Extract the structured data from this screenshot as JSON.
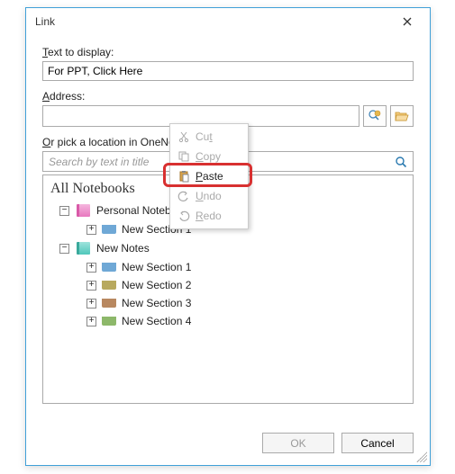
{
  "dialog": {
    "title": "Link",
    "text_to_display_label": "Text to display:",
    "text_to_display_value": "For PPT, Click Here",
    "address_label": "Address:",
    "address_value": "",
    "pick_location_label": "Or pick a location in OneNote:",
    "search_placeholder": "Search by text in title",
    "ok_label": "OK",
    "cancel_label": "Cancel"
  },
  "tree": {
    "header": "All Notebooks",
    "notebooks": [
      {
        "name": "Personal Notebook",
        "color": "pink",
        "expanded": true,
        "sections": [
          {
            "name": "New Section 1",
            "color": "blue"
          }
        ]
      },
      {
        "name": "New Notes",
        "color": "teal",
        "expanded": true,
        "sections": [
          {
            "name": "New Section 1",
            "color": "blue"
          },
          {
            "name": "New Section 2",
            "color": "olive"
          },
          {
            "name": "New Section 3",
            "color": "brown"
          },
          {
            "name": "New Section 4",
            "color": "green"
          }
        ]
      }
    ]
  },
  "context_menu": {
    "items": [
      {
        "label": "Cut",
        "accel": "t",
        "enabled": false,
        "icon": "cut"
      },
      {
        "label": "Copy",
        "accel": "C",
        "enabled": false,
        "icon": "copy"
      },
      {
        "label": "Paste",
        "accel": "P",
        "enabled": true,
        "icon": "paste"
      },
      {
        "label": "Undo",
        "accel": "U",
        "enabled": false,
        "icon": "undo"
      },
      {
        "label": "Redo",
        "accel": "R",
        "enabled": false,
        "icon": "redo"
      }
    ]
  }
}
